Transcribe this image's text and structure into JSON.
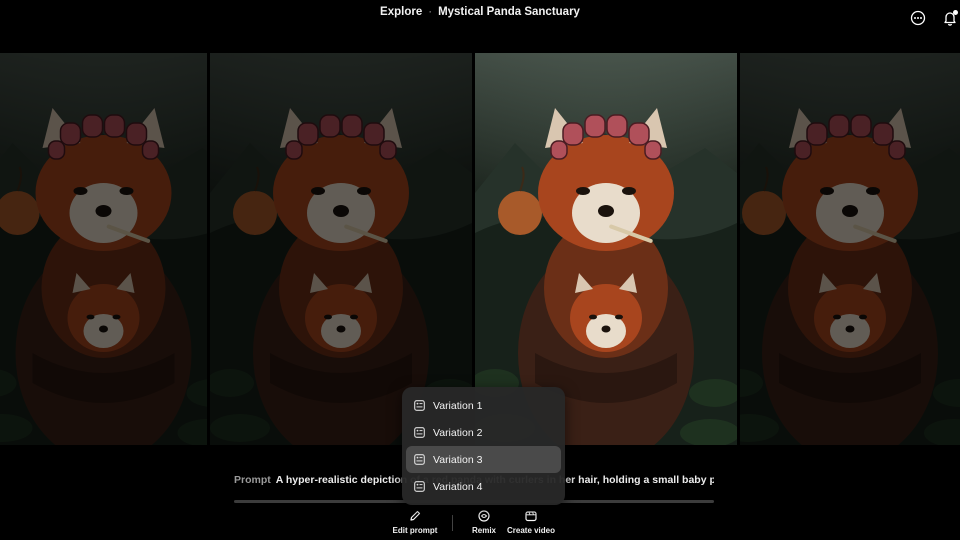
{
  "header": {
    "breadcrumb_root": "Explore",
    "separator": "·",
    "title": "Mystical Panda Sanctuary",
    "subtitle": "",
    "more_icon": "more-horizontal-icon",
    "notifications_icon": "bell-icon",
    "has_notification": true
  },
  "gallery": {
    "variations": [
      {
        "label": "Variation 1",
        "dimmed": true
      },
      {
        "label": "Variation 2",
        "dimmed": true
      },
      {
        "label": "Variation 3",
        "dimmed": false
      },
      {
        "label": "Variation 4",
        "dimmed": true
      }
    ]
  },
  "prompt": {
    "label": "Prompt",
    "text": "A hyper-realistic depiction of a red panda with curlers in her hair, holding a small baby pan..."
  },
  "actions": {
    "edit_prompt": "Edit prompt",
    "remix": "Remix",
    "create_video": "Create video"
  },
  "menu": {
    "items": [
      "Variation 1",
      "Variation 2",
      "Variation 3",
      "Variation 4"
    ],
    "selected_index": 2
  },
  "colors": {
    "background": "#000000",
    "menu_bg": "#282828",
    "menu_active": "#4a4a4a",
    "fur": "#a8451e",
    "curlers": "#b0505a"
  }
}
